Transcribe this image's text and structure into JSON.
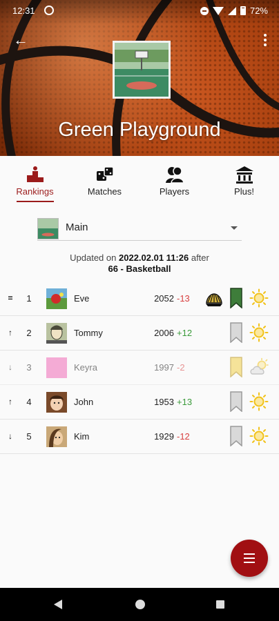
{
  "status_bar": {
    "time": "12:31",
    "battery": "72%"
  },
  "header": {
    "title": "Green Playground"
  },
  "tabs": [
    {
      "label": "Rankings",
      "active": true,
      "icon": "podium-icon"
    },
    {
      "label": "Matches",
      "active": false,
      "icon": "dice-icon"
    },
    {
      "label": "Players",
      "active": false,
      "icon": "people-icon"
    },
    {
      "label": "Plus!",
      "active": false,
      "icon": "temple-icon"
    }
  ],
  "selector": {
    "label": "Main"
  },
  "updated": {
    "prefix": "Updated on",
    "datetime": "2022.02.01 11:26",
    "suffix": "after",
    "count_sport": "66 - Basketball"
  },
  "rankings": [
    {
      "trend": "=",
      "rank": "1",
      "name": "Eve",
      "score": "2052",
      "delta": "-13",
      "delta_sign": "neg",
      "medal": "laurel-crown",
      "bookmark": "green",
      "weather": "sun"
    },
    {
      "trend": "↑",
      "rank": "2",
      "name": "Tommy",
      "score": "2006",
      "delta": "+12",
      "delta_sign": "pos",
      "medal": "",
      "bookmark": "gray",
      "weather": "sun"
    },
    {
      "trend": "↓",
      "rank": "3",
      "name": "Keyra",
      "score": "1997",
      "delta": "-2",
      "delta_sign": "neg",
      "medal": "",
      "bookmark": "gold",
      "weather": "partly-cloudy",
      "faded": true
    },
    {
      "trend": "↑",
      "rank": "4",
      "name": "John",
      "score": "1953",
      "delta": "+13",
      "delta_sign": "pos",
      "medal": "",
      "bookmark": "gray",
      "weather": "sun"
    },
    {
      "trend": "↓",
      "rank": "5",
      "name": "Kim",
      "score": "1929",
      "delta": "-12",
      "delta_sign": "neg",
      "medal": "",
      "bookmark": "gray",
      "weather": "sun"
    }
  ],
  "colors": {
    "accent": "#9b1b1b",
    "fab": "#a10f12",
    "positive": "#3a9a3a",
    "negative": "#d84040"
  }
}
